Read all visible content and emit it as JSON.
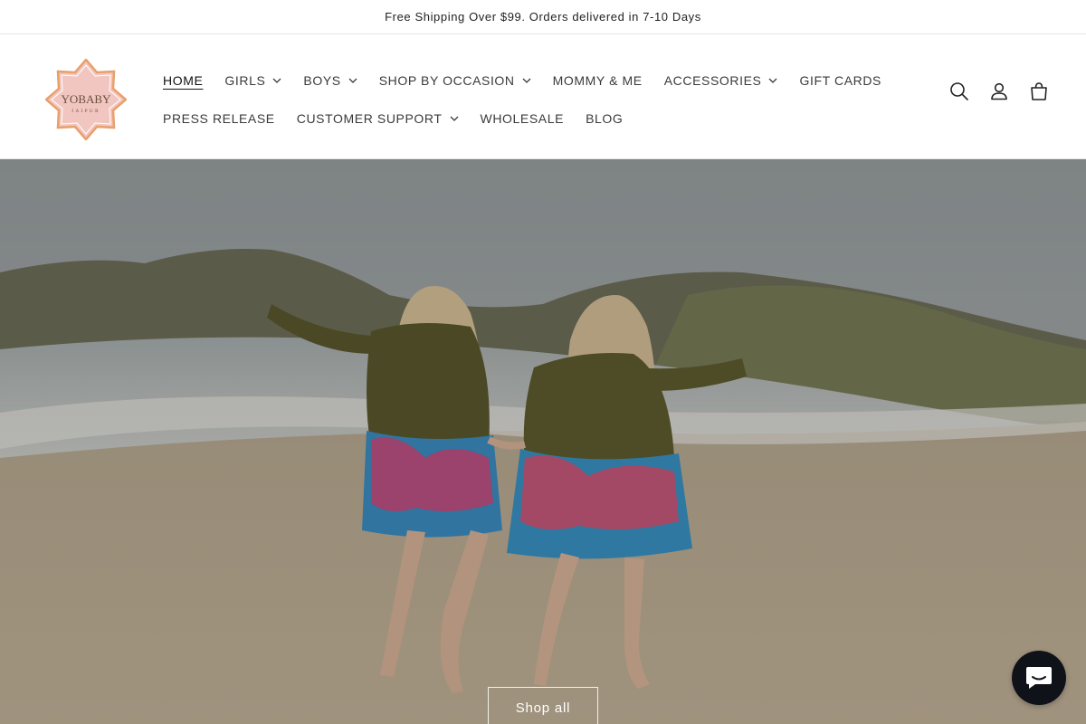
{
  "announcement": "Free Shipping Over $99. Orders delivered in 7-10 Days",
  "brand": {
    "logo_text": "YOBABY",
    "logo_subtext": "JAIPUR"
  },
  "nav": {
    "items": [
      {
        "label": "HOME",
        "active": true,
        "dropdown": false
      },
      {
        "label": "GIRLS",
        "dropdown": true
      },
      {
        "label": "BOYS",
        "dropdown": true
      },
      {
        "label": "SHOP BY OCCASION",
        "dropdown": true
      },
      {
        "label": "MOMMY & ME",
        "dropdown": false
      },
      {
        "label": "ACCESSORIES",
        "dropdown": true
      },
      {
        "label": "GIFT CARDS",
        "dropdown": false
      },
      {
        "label": "PRESS RELEASE",
        "dropdown": false
      },
      {
        "label": "CUSTOMER SUPPORT",
        "dropdown": true
      },
      {
        "label": "WHOLESALE",
        "dropdown": false
      },
      {
        "label": "BLOG",
        "dropdown": false
      }
    ]
  },
  "header_icons": [
    "search-icon",
    "account-icon",
    "cart-icon"
  ],
  "hero": {
    "button_label": "Shop all"
  },
  "chat": {
    "icon": "chat-icon"
  },
  "colors": {
    "logo_pink": "#f2c6c0",
    "logo_outline": "#e8a06a",
    "chat_bg": "#101219"
  }
}
